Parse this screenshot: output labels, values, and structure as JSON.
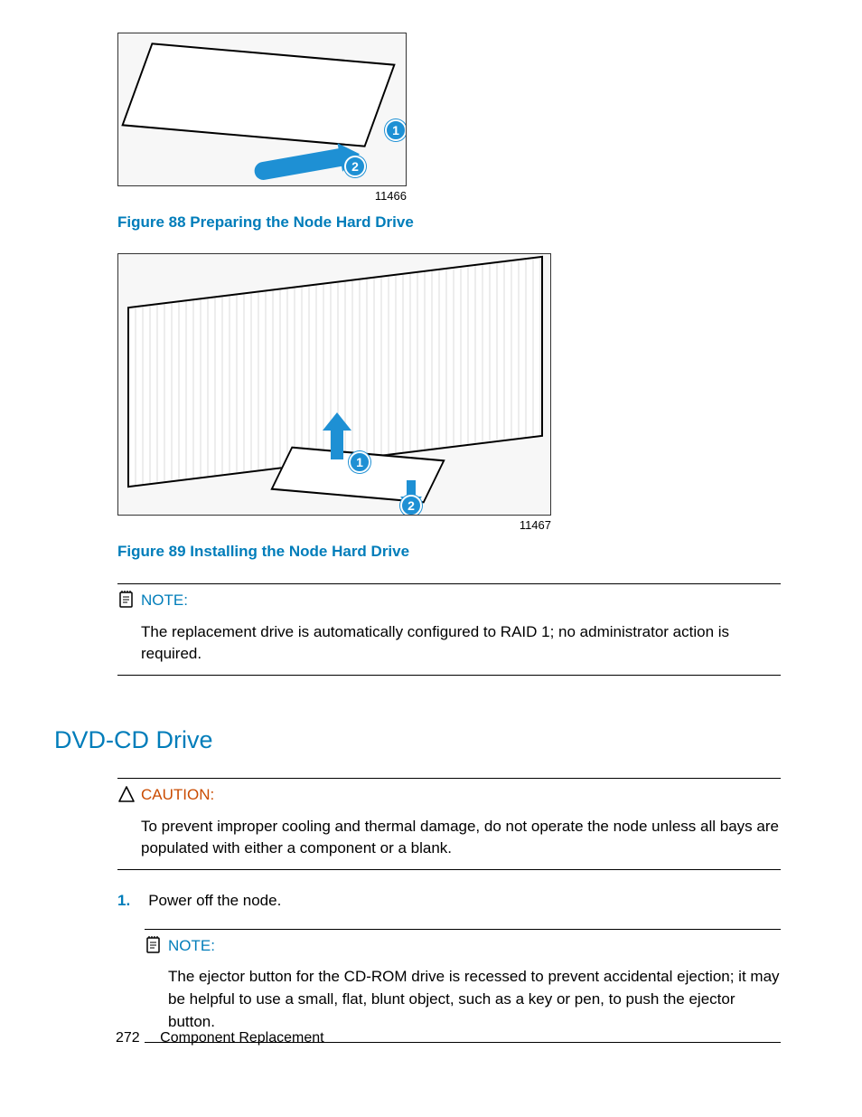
{
  "figures": {
    "fig1_diagram_id": "11466",
    "fig1_caption": "Figure 88 Preparing the Node Hard Drive",
    "fig1_callout_1": "1",
    "fig1_callout_2": "2",
    "fig2_diagram_id": "11467",
    "fig2_caption": "Figure 89 Installing the Node Hard Drive",
    "fig2_callout_1": "1",
    "fig2_callout_2": "2"
  },
  "notes": {
    "note1_title": "NOTE:",
    "note1_body": "The replacement drive is automatically configured to RAID 1; no administrator action is required.",
    "caution_title": "CAUTION:",
    "caution_body": "To prevent improper cooling and thermal damage, do not operate the node unless all bays are populated with either a component or a blank.",
    "note2_title": "NOTE:",
    "note2_body": "The ejector button for the CD-ROM drive is recessed to prevent accidental ejection; it may be helpful to use a small, flat, blunt object, such as a key or pen, to push the ejector button."
  },
  "section_heading": "DVD-CD Drive",
  "steps": {
    "step1_num": "1.",
    "step1_text": "Power off the node."
  },
  "footer": {
    "page_number": "272",
    "section_name": "Component Replacement"
  }
}
